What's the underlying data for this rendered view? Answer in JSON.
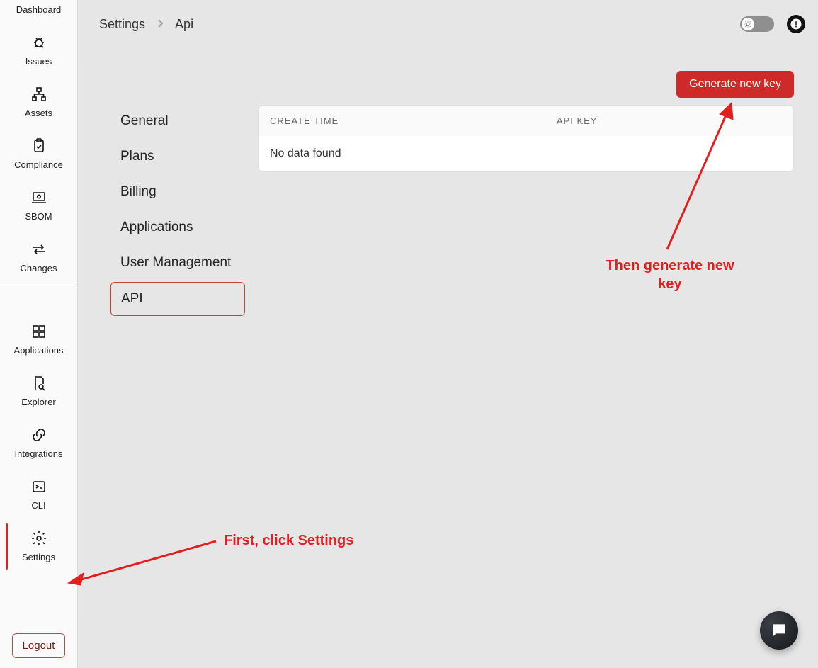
{
  "breadcrumb": {
    "root": "Settings",
    "leaf": "Api"
  },
  "sidebar": {
    "dashboard": "Dashboard",
    "issues": "Issues",
    "assets": "Assets",
    "compliance": "Compliance",
    "sbom": "SBOM",
    "changes": "Changes",
    "applications": "Applications",
    "explorer": "Explorer",
    "integrations": "Integrations",
    "cli": "CLI",
    "settings": "Settings",
    "logout": "Logout"
  },
  "actions": {
    "generate_key": "Generate new key"
  },
  "settings_tabs": {
    "general": "General",
    "plans": "Plans",
    "billing": "Billing",
    "applications": "Applications",
    "user_mgmt": "User Management",
    "api": "API"
  },
  "table": {
    "col_create_time": "CREATE TIME",
    "col_api_key": "API KEY",
    "empty": "No data found"
  },
  "annotations": {
    "step1": "First, click Settings",
    "step2": "Then generate new key"
  },
  "colors": {
    "brand_red": "#ce2a2a",
    "annotation_red": "#e21f1f"
  }
}
